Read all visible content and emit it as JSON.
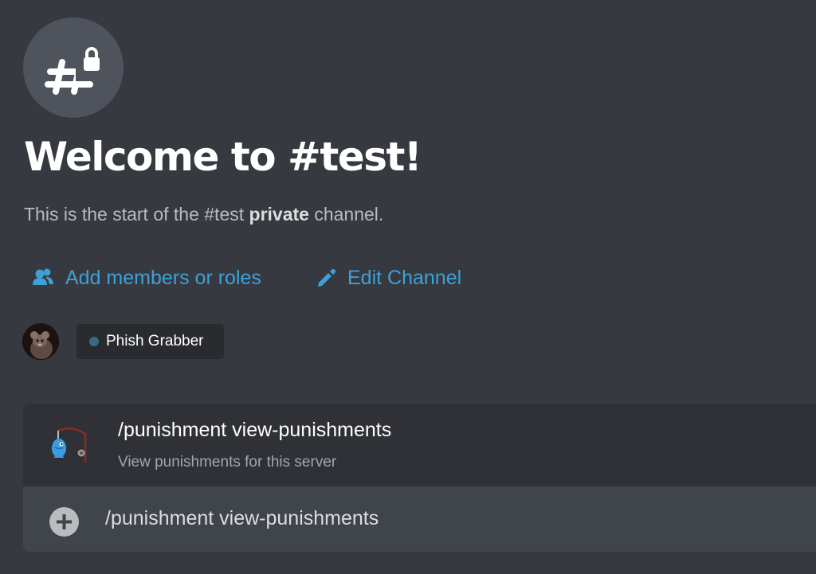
{
  "welcome": {
    "icon": "hashtag-lock-icon",
    "title": "Welcome to #test!",
    "subtitle_prefix": "This is the start of the #test ",
    "subtitle_bold": "private",
    "subtitle_suffix": " channel."
  },
  "actions": {
    "add_members": {
      "icon": "add-members-icon",
      "label": "Add members or roles"
    },
    "edit_channel": {
      "icon": "pencil-icon",
      "label": "Edit Channel"
    }
  },
  "member": {
    "name": "Phish Grabber",
    "status_color": "#3a6a82"
  },
  "command": {
    "icon": "fishing-bot-icon",
    "name": "/punishment view-punishments",
    "description": "View punishments for this server"
  },
  "input": {
    "value": "/punishment view-punishments",
    "plus_icon": "plus-circle-icon"
  },
  "colors": {
    "background": "#36393f",
    "link": "#3fa0d8",
    "input_bg": "#40444b",
    "autocomplete_bg": "#2f3136"
  }
}
